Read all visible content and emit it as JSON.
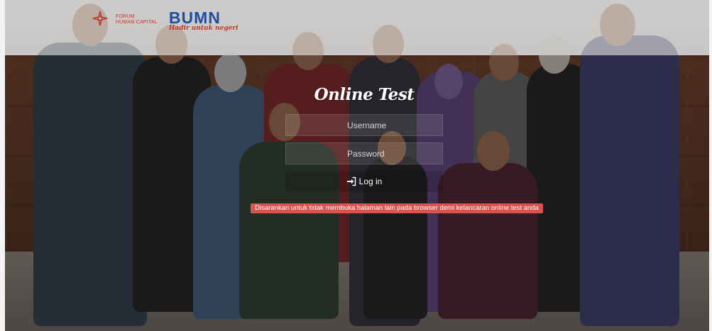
{
  "header": {
    "fhci_logo_text_line1": "FORUM",
    "fhci_logo_text_line2": "HUMAN CAPITAL",
    "bumn_title": "BUMN",
    "bumn_tagline": "Hadir untuk negeri"
  },
  "login": {
    "title": "Online Test",
    "username_placeholder": "Username",
    "password_placeholder": "Password",
    "login_button_label": "Log in"
  },
  "notice": {
    "text": "Disarankan untuk tidak membuka halaman lain pada browser demi kelancaran online test anda"
  },
  "colors": {
    "warning_bg": "#d9534f",
    "bumn_blue": "#1e4fa1",
    "brand_red": "#c0392b"
  },
  "icons": {
    "login_icon": "sign-in-icon",
    "fhci_icon": "fhci-star-icon"
  }
}
